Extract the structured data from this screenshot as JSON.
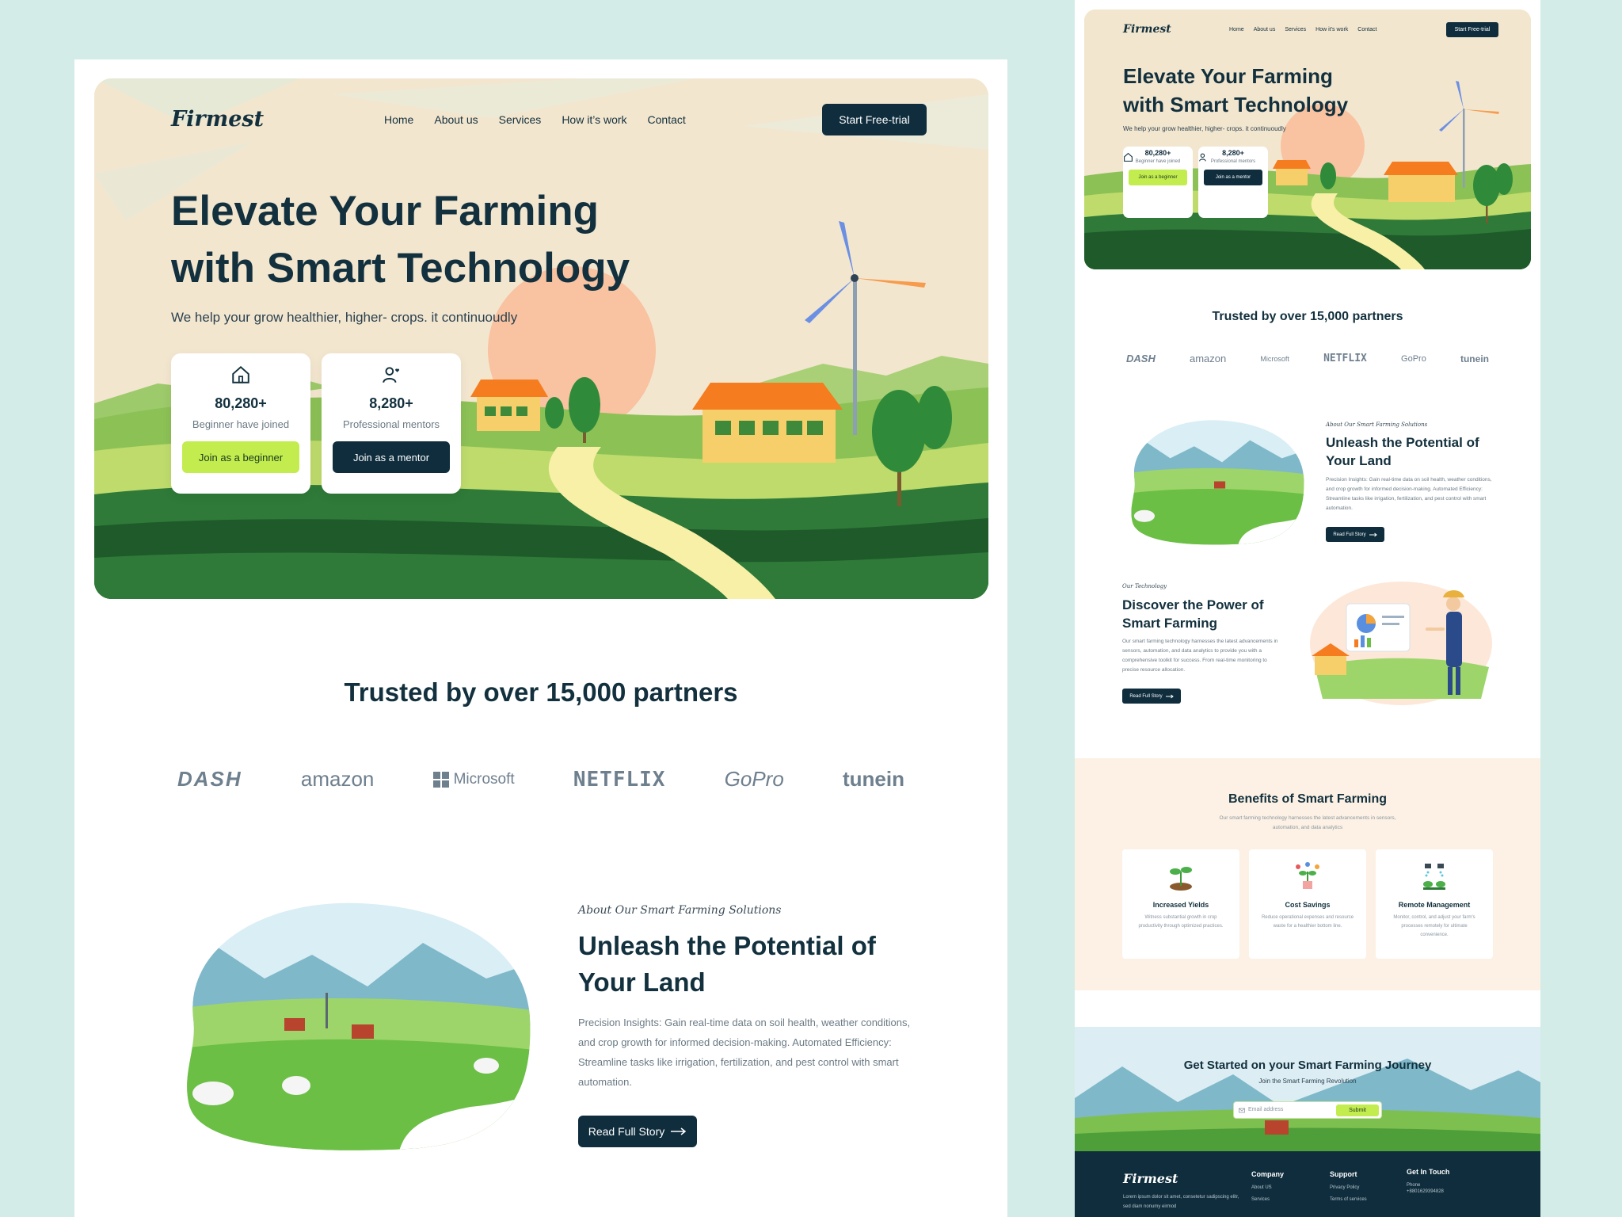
{
  "brand": "Firmest",
  "nav": {
    "links": [
      "Home",
      "About us",
      "Services",
      "How it’s work",
      "Contact"
    ],
    "cta": "Start Free-trial"
  },
  "hero": {
    "title": "Elevate Your Farming with Smart Technology",
    "subtitle": "We help your grow healthier, higher- crops. it continuoudly",
    "stats": [
      {
        "icon": "home-icon",
        "value": "80,280+",
        "label": "Beginner have joined",
        "button": "Join as a beginner"
      },
      {
        "icon": "user-heart-icon",
        "value": "8,280+",
        "label": "Professional mentors",
        "button": "Join as a mentor"
      }
    ]
  },
  "trusted": {
    "title": "Trusted by over 15,000 partners",
    "logos": [
      "DASH",
      "amazon",
      "Microsoft",
      "NETFLIX",
      "GoPro",
      "tunein"
    ]
  },
  "about": {
    "eyebrow": "About Our Smart Farming Solutions",
    "title": "Unleash the Potential of Your Land",
    "text": "Precision Insights: Gain real-time data on soil health, weather conditions, and crop growth for informed decision-making. Automated Efficiency: Streamline tasks like irrigation, fertilization, and pest control with smart automation.",
    "button": "Read Full Story"
  },
  "technology": {
    "eyebrow": "Our Technology",
    "title": "Discover the Power of Smart Farming",
    "text": "Our smart farming technology harnesses the latest advancements in sensors, automation, and data analytics to provide you with a comprehensive toolkit for success. From real-time monitoring to precise resource allocation.",
    "button": "Read Full Story"
  },
  "benefits": {
    "title": "Benefits of Smart Farming",
    "subtitle": "Our smart farming technology harnesses the latest advancements in sensors, automation, and data analytics",
    "items": [
      {
        "icon": "sprout-icon",
        "title": "Increased Yields",
        "text": "Witness substantial growth in crop productivity through optimized practices."
      },
      {
        "icon": "plant-coins-icon",
        "title": "Cost Savings",
        "text": "Reduce operational expenses and resource waste for a healthier bottom line."
      },
      {
        "icon": "sprinkler-icon",
        "title": "Remote Management",
        "text": "Monitor, control, and adjust your farm's processes remotely for ultimate convenience."
      }
    ]
  },
  "journey": {
    "title": "Get Started on your Smart Farming Journey",
    "subtitle": "Join the Smart Farming Revolution",
    "placeholder": "Email address",
    "button": "Submit"
  },
  "footer": {
    "description": "Lorem ipsum dolor sit amet, consetetur sadipscing elitr, sed diam nonumy eirmod",
    "company": {
      "title": "Company",
      "links": [
        "About US",
        "Services"
      ]
    },
    "support": {
      "title": "Support",
      "links": [
        "Privacy Policy",
        "Terms of services"
      ]
    },
    "contact": {
      "title": "Get In Touch",
      "phone_label": "Phone",
      "phone": "+8801629394828"
    }
  },
  "colors": {
    "navy": "#0f2d3d",
    "lime": "#c3ec4f",
    "bg": "#d3ece8",
    "cream": "#f3e6cf"
  }
}
